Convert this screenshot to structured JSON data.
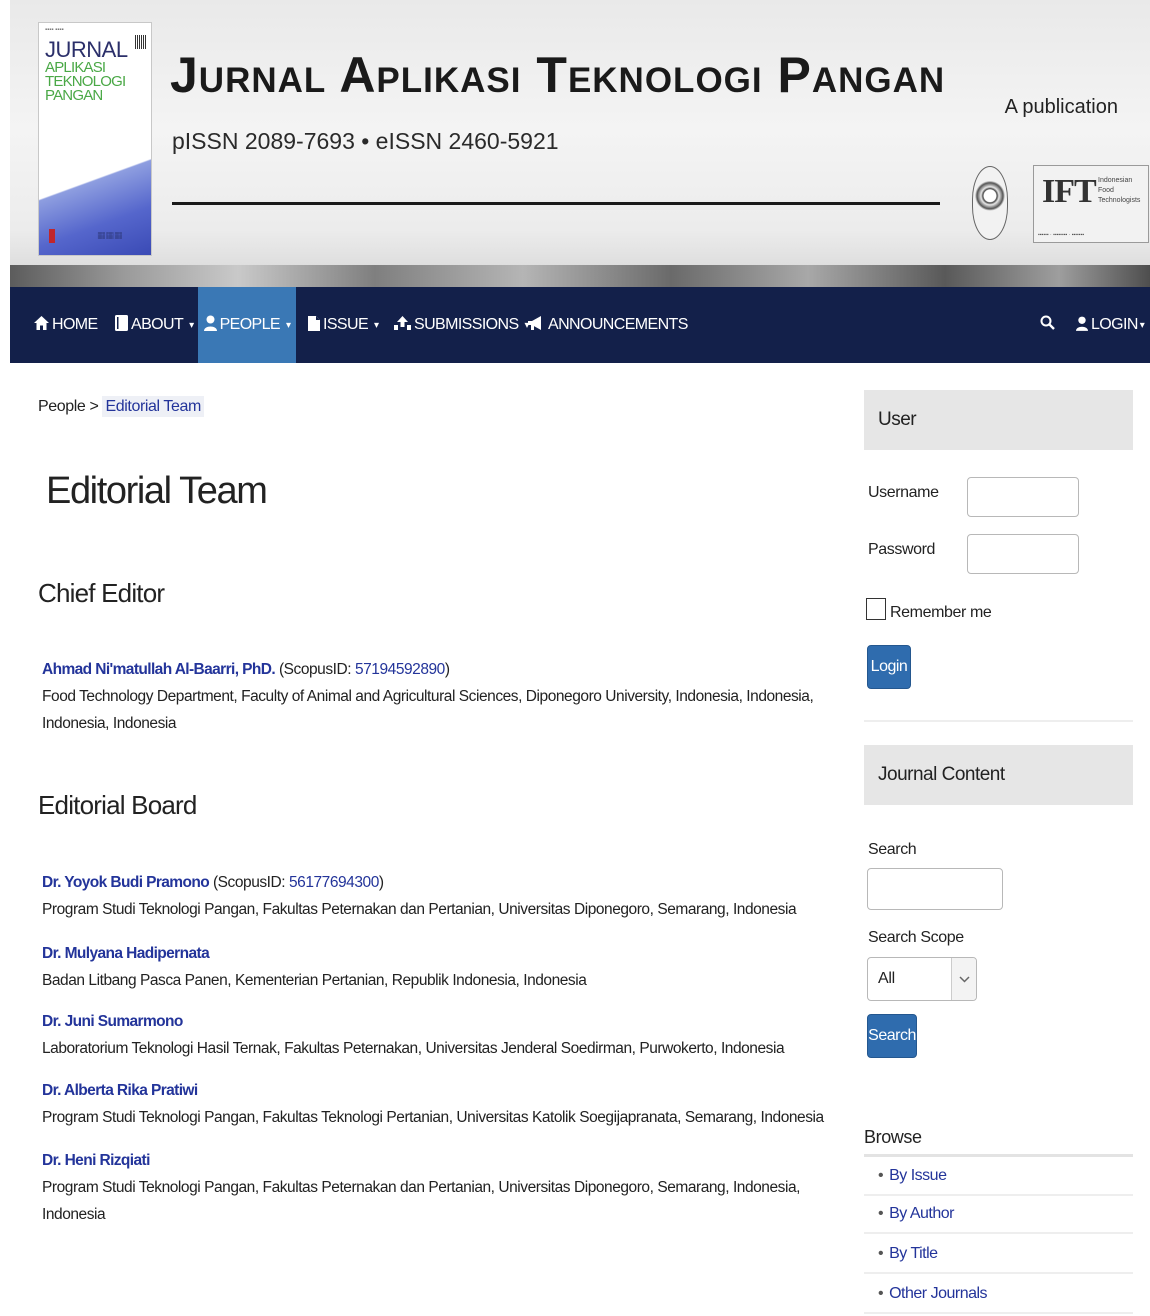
{
  "header": {
    "title": "Jurnal Aplikasi Teknologi Pangan",
    "issn": "pISSN 2089-7693 • eISSN 2460-5921",
    "publication": "A publication",
    "cover": {
      "title_line1": "JURNAL",
      "title_line2": "APLIKASI\nTEKNOLOGI\nPANGAN"
    },
    "ift_logo": {
      "letters": "IFT",
      "subtitle": "Indonesian Food Technologists"
    }
  },
  "nav": {
    "items": [
      {
        "label": "HOME",
        "icon": "home-icon"
      },
      {
        "label": "ABOUT",
        "icon": "book-icon"
      },
      {
        "label": "PEOPLE",
        "icon": "user-icon"
      },
      {
        "label": "ISSUE",
        "icon": "file-icon"
      },
      {
        "label": "SUBMISSIONS",
        "icon": "upload-icon"
      },
      {
        "label": "ANNOUNCEMENTS",
        "icon": "bullhorn-icon"
      }
    ],
    "search_icon": "search-icon",
    "login_label": "LOGIN"
  },
  "breadcrumb": {
    "parent": "People",
    "current": "Editorial Team"
  },
  "page_title": "Editorial Team",
  "sections": {
    "chief_editor": {
      "heading": "Chief Editor",
      "members": [
        {
          "name": "Ahmad Ni'matullah Al-Baarri, PhD.",
          "scopus_prefix": "(ScopusID: ",
          "scopus_id": "57194592890",
          "scopus_suffix": ")",
          "affiliation": "Food Technology Department, Faculty of Animal and Agricultural Sciences, Diponegoro University, Indonesia, Indonesia, Indonesia, Indonesia"
        }
      ]
    },
    "editorial_board": {
      "heading": "Editorial Board",
      "members": [
        {
          "name": "Dr. Yoyok Budi Pramono",
          "scopus_prefix": "(ScopusID: ",
          "scopus_id": "56177694300",
          "scopus_suffix": ")",
          "affiliation": "Program Studi Teknologi Pangan, Fakultas Peternakan dan Pertanian, Universitas Diponegoro, Semarang, Indonesia"
        },
        {
          "name": "Dr. Mulyana Hadipernata",
          "affiliation": "Badan Litbang Pasca Panen, Kementerian Pertanian, Republik Indonesia, Indonesia"
        },
        {
          "name": "Dr. Juni Sumarmono",
          "affiliation": "Laboratorium Teknologi Hasil Ternak, Fakultas Peternakan, Universitas Jenderal Soedirman, Purwokerto, Indonesia"
        },
        {
          "name": "Dr. Alberta Rika Pratiwi",
          "affiliation": "Program Studi Teknologi Pangan, Fakultas Teknologi Pertanian, Universitas Katolik Soegijapranata, Semarang, Indonesia"
        },
        {
          "name": "Dr. Heni Rizqiati",
          "affiliation": "Program Studi Teknologi Pangan, Fakultas Peternakan dan Pertanian, Universitas Diponegoro, Semarang, Indonesia, Indonesia"
        }
      ]
    }
  },
  "sidebar": {
    "user_block": {
      "title": "User",
      "username_label": "Username",
      "username_value": "",
      "password_label": "Password",
      "password_value": "",
      "remember_label": "Remember me",
      "login_button": "Login"
    },
    "journal_content": {
      "title": "Journal Content",
      "search_label": "Search",
      "search_value": "",
      "scope_label": "Search Scope",
      "scope_selected": "All",
      "search_button": "Search"
    },
    "browse": {
      "title": "Browse",
      "items": [
        "By Issue",
        "By Author",
        "By Title",
        "Other Journals"
      ]
    }
  },
  "colors": {
    "nav_background": "#13204a",
    "nav_active": "#3a78b5",
    "link": "#23349a",
    "button": "#2f6cae"
  }
}
